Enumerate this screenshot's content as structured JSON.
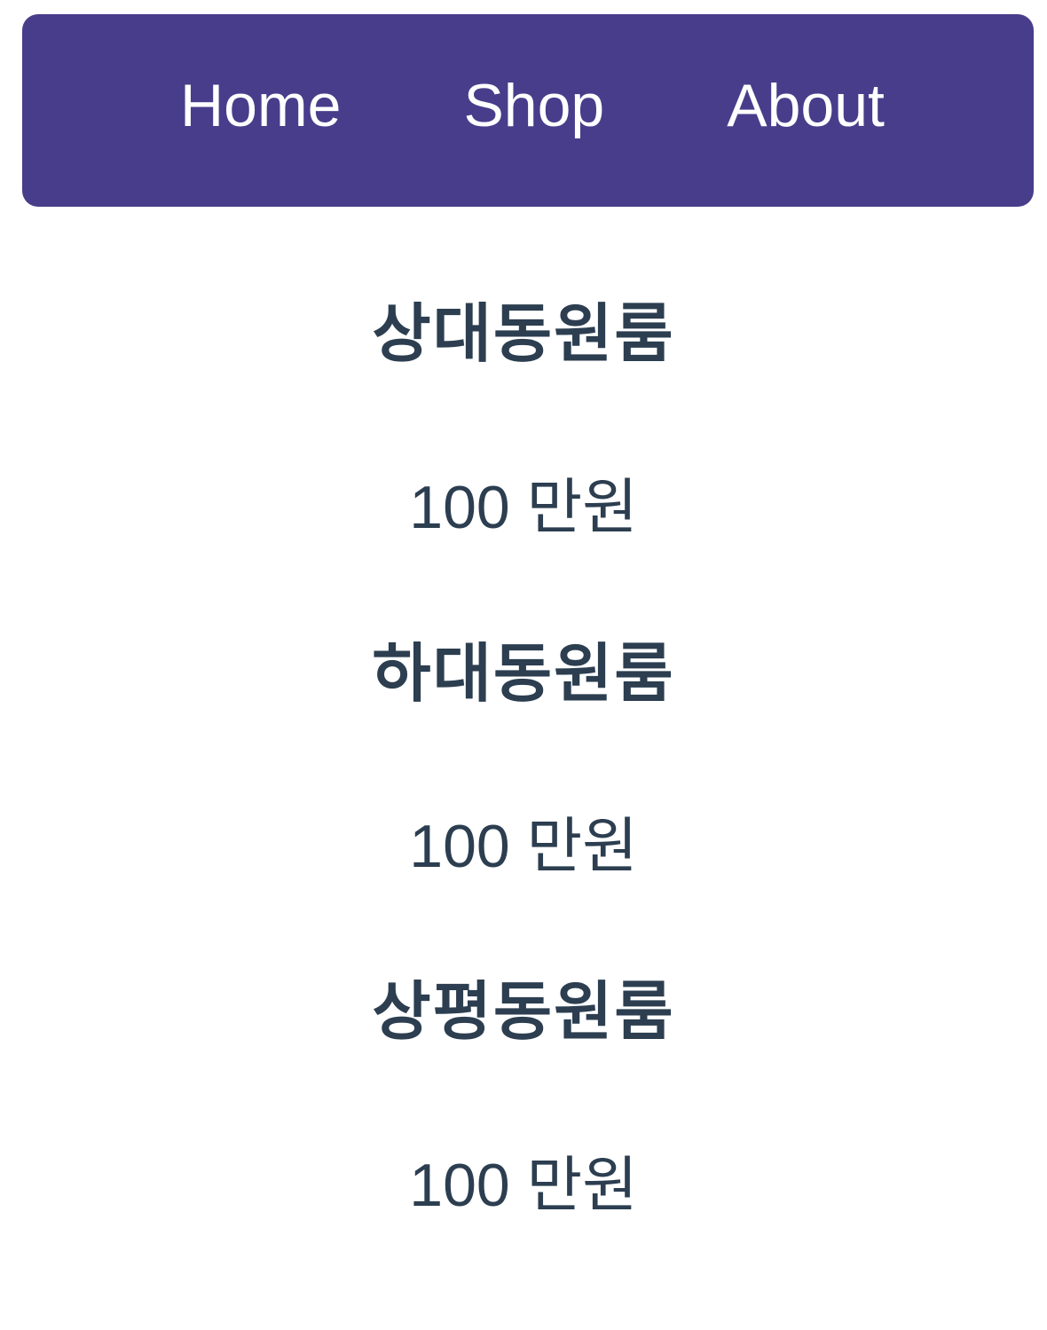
{
  "nav": {
    "items": [
      {
        "label": "Home"
      },
      {
        "label": "Shop"
      },
      {
        "label": "About"
      }
    ]
  },
  "listings": [
    {
      "title": "상대동원룸",
      "price": "100 만원"
    },
    {
      "title": "하대동원룸",
      "price": "100 만원"
    },
    {
      "title": "상평동원룸",
      "price": "100 만원"
    }
  ],
  "colors": {
    "nav_background": "#483d8b",
    "nav_text": "#ffffff",
    "body_text": "#2c3e50"
  }
}
